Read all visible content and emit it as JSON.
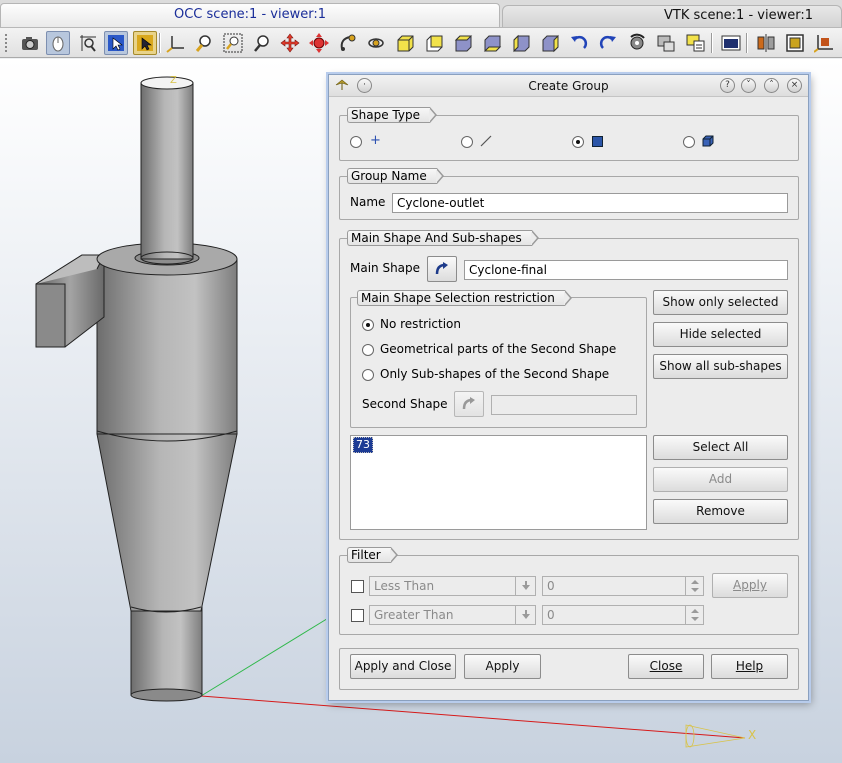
{
  "tabs": {
    "occ": "OCC scene:1 - viewer:1",
    "vtk": "VTK scene:1 - viewer:1"
  },
  "toolbar": {
    "icons": [
      "dump-view-icon",
      "interaction-style-icon",
      "zoom-style-icon",
      "select-rect-icon",
      "select-highlight-icon",
      "trihedron-icon",
      "fit-all-icon",
      "fit-area-icon",
      "zoom-icon",
      "pan-icon",
      "global-pan-icon",
      "rotate-icon",
      "rotation-point-icon",
      "front-view-icon",
      "back-view-icon",
      "top-view-icon",
      "bottom-view-icon",
      "left-view-icon",
      "right-view-icon",
      "rotate-counterclockwise-icon",
      "rotate-clockwise-icon",
      "reset-view-icon",
      "memorize-view-icon",
      "restore-view-icon",
      "clone-view-icon",
      "clipping-icon",
      "scaling-icon",
      "graduated-axes-icon"
    ]
  },
  "viewer": {
    "axis_x": "X",
    "axis_z": "Z"
  },
  "dialog": {
    "title": "Create Group",
    "shape_type": {
      "legend": "Shape Type",
      "options": [
        "vertex",
        "edge",
        "face",
        "solid"
      ],
      "selected": "face"
    },
    "group_name": {
      "legend": "Group Name",
      "label": "Name",
      "value": "Cyclone-outlet"
    },
    "main_shape": {
      "legend": "Main Shape And Sub-shapes",
      "label": "Main Shape",
      "value": "Cyclone-final",
      "restriction": {
        "legend": "Main Shape Selection restriction",
        "options": [
          "No restriction",
          "Geometrical parts of the Second Shape",
          "Only Sub-shapes of the Second Shape"
        ],
        "selected_index": 0,
        "second_shape_label": "Second Shape",
        "second_shape_value": ""
      },
      "buttons": {
        "show_only_selected": "Show only selected",
        "hide_selected": "Hide selected",
        "show_all": "Show all sub-shapes"
      },
      "list_items": [
        "73"
      ],
      "list_buttons": {
        "select_all": "Select All",
        "add": "Add",
        "remove": "Remove"
      }
    },
    "filter": {
      "legend": "Filter",
      "less": {
        "condition": "Less Than",
        "value": "0"
      },
      "greater": {
        "condition": "Greater Than",
        "value": "0"
      },
      "apply": "Apply"
    },
    "footer": {
      "apply_and_close": "Apply and Close",
      "apply": "Apply",
      "close": "Close",
      "help": "Help"
    }
  },
  "colors": {
    "dialog_border": "#8aa0bf",
    "selection": "#1c3b94",
    "tab_text": "#1a2d99",
    "axis_label": "#d8c34a"
  }
}
